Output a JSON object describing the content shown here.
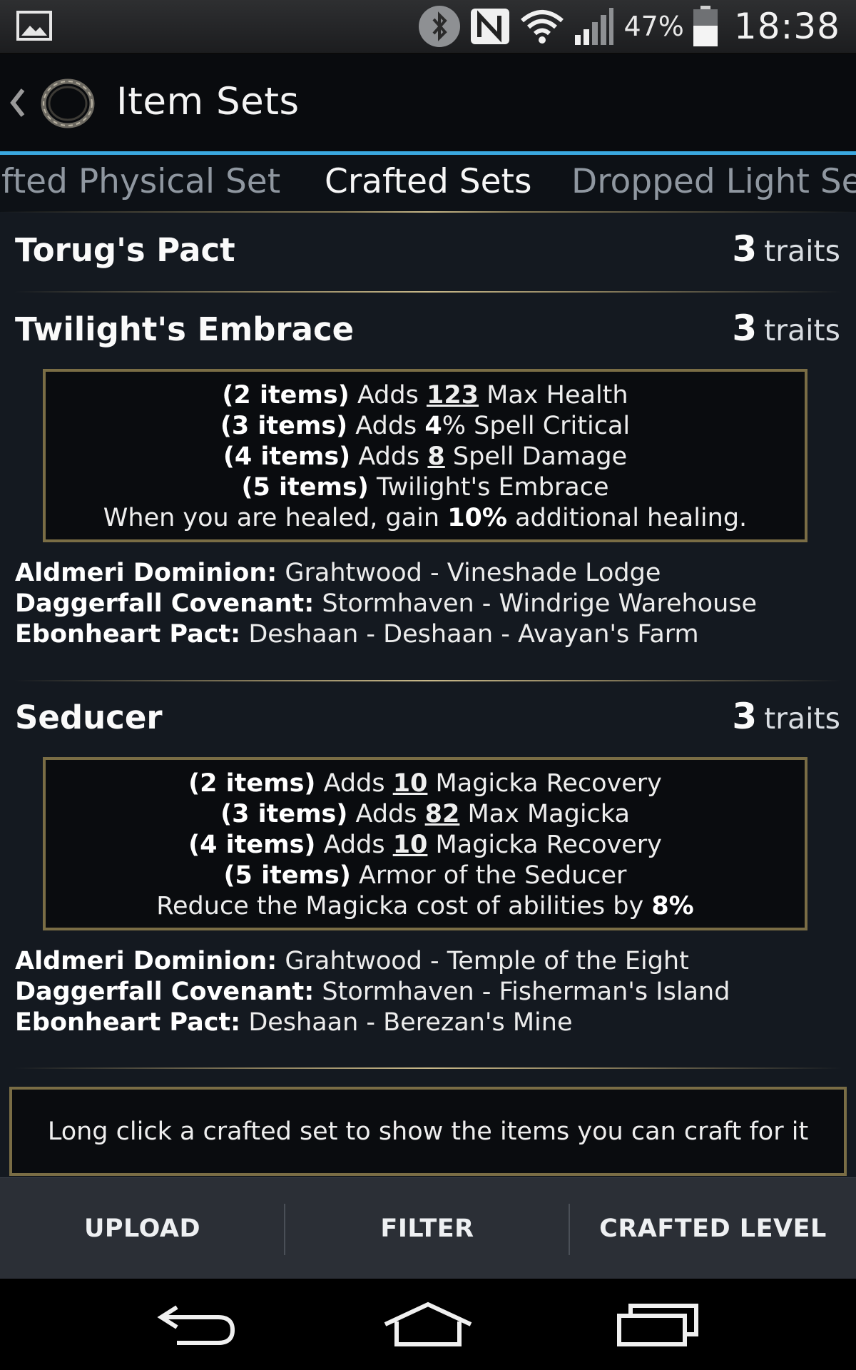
{
  "status_bar": {
    "battery_percent": "47%",
    "time": "18:38",
    "icons": [
      "gallery-icon",
      "bluetooth-icon",
      "nfc-icon",
      "wifi-icon",
      "signal-icon",
      "battery-icon"
    ]
  },
  "app_bar": {
    "title": "Item Sets",
    "icons": [
      "back-chevron-icon",
      "app-logo-icon"
    ]
  },
  "tabs": [
    {
      "label": "fted Physical Set",
      "active": false
    },
    {
      "label": "Crafted Sets",
      "active": true
    },
    {
      "label": "Dropped Light Se",
      "active": false
    }
  ],
  "sets": [
    {
      "name": "Torug's Pact",
      "traits_count": "3",
      "traits_label": "traits"
    },
    {
      "name": "Twilight's Embrace",
      "traits_count": "3",
      "traits_label": "traits",
      "bonuses": [
        {
          "items": "(2 items)",
          "pre": " Adds ",
          "value": "123",
          "post": " Max Health"
        },
        {
          "items": "(3 items)",
          "pre": " Adds ",
          "value": "4",
          "post": "% Spell Critical"
        },
        {
          "items": "(4 items)",
          "pre": " Adds ",
          "value": "8",
          "post": " Spell Damage"
        },
        {
          "items": "(5 items)",
          "pre": " Twilight's Embrace",
          "value": "",
          "post": ""
        }
      ],
      "bonus_desc": {
        "pre": "When you are healed, gain ",
        "value": "10%",
        "post": " additional healing."
      },
      "locations": [
        {
          "faction": "Aldmeri Dominion:",
          "place": " Grahtwood - Vineshade Lodge"
        },
        {
          "faction": "Daggerfall Covenant:",
          "place": " Stormhaven - Windrige Warehouse"
        },
        {
          "faction": "Ebonheart Pact:",
          "place": " Deshaan - Deshaan - Avayan's Farm"
        }
      ]
    },
    {
      "name": "Seducer",
      "traits_count": "3",
      "traits_label": "traits",
      "bonuses": [
        {
          "items": "(2 items)",
          "pre": " Adds ",
          "value": "10",
          "post": " Magicka Recovery"
        },
        {
          "items": "(3 items)",
          "pre": " Adds ",
          "value": "82",
          "post": " Max Magicka"
        },
        {
          "items": "(4 items)",
          "pre": " Adds ",
          "value": "10",
          "post": " Magicka Recovery"
        },
        {
          "items": "(5 items)",
          "pre": " Armor of the Seducer",
          "value": "",
          "post": ""
        }
      ],
      "bonus_desc": {
        "pre": "Reduce the Magicka cost of abilities by ",
        "value": "8%",
        "post": ""
      },
      "locations": [
        {
          "faction": "Aldmeri Dominion:",
          "place": " Grahtwood - Temple of the Eight"
        },
        {
          "faction": "Daggerfall Covenant:",
          "place": " Stormhaven - Fisherman's Island"
        },
        {
          "faction": "Ebonheart Pact:",
          "place": " Deshaan - Berezan's Mine"
        }
      ]
    }
  ],
  "hint": "Long click a crafted set to show the items you can craft for it",
  "actions": {
    "upload": "UPLOAD",
    "filter": "FILTER",
    "crafted_level": "CRAFTED LEVEL"
  },
  "nav": [
    "back-icon",
    "home-icon",
    "recents-icon"
  ],
  "colors": {
    "accent_line": "#3aa8e0",
    "gold_border": "#7a6d45",
    "background": "#141920"
  }
}
